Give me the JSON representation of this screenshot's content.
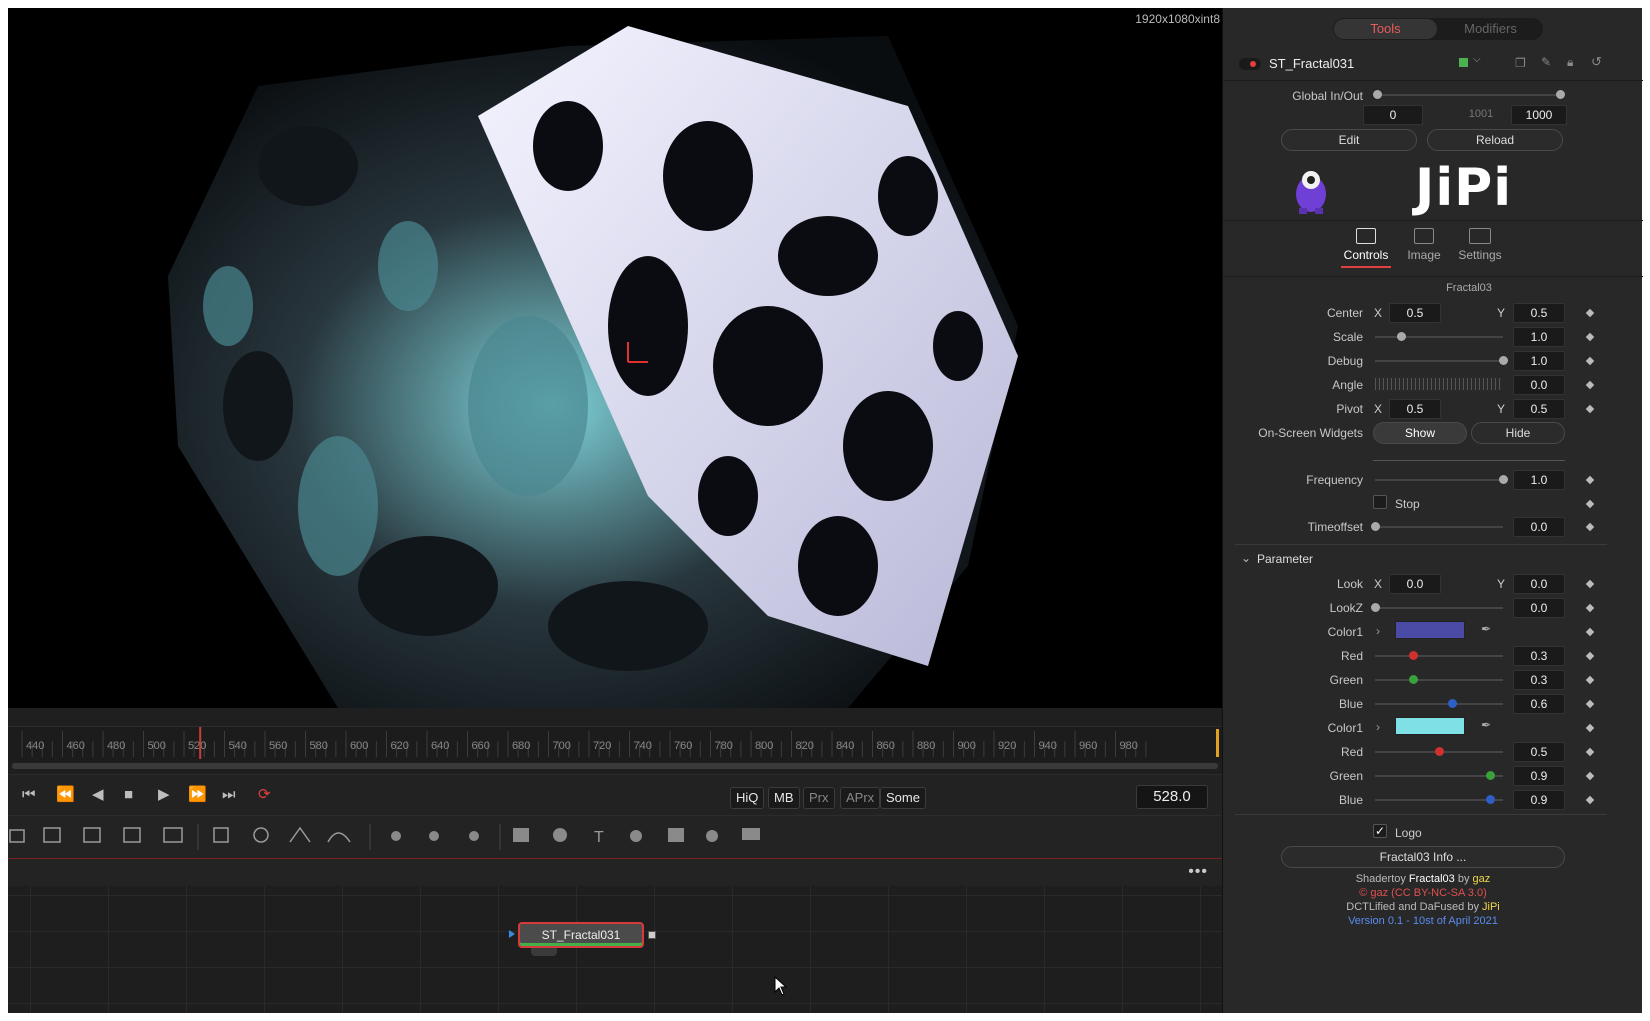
{
  "viewer": {
    "resolution": "1920x1080xint8"
  },
  "timeline": {
    "ticks": [
      "440",
      "460",
      "480",
      "500",
      "520",
      "540",
      "560",
      "580",
      "600",
      "620",
      "640",
      "660",
      "680",
      "700",
      "720",
      "740",
      "760",
      "780",
      "800",
      "820",
      "840",
      "860",
      "880",
      "900",
      "920",
      "940",
      "960",
      "980"
    ],
    "current_frame": "528.0"
  },
  "playback": {
    "hiq": "HiQ",
    "mb": "MB",
    "prx": "Prx",
    "aprx": "APrx",
    "some": "Some"
  },
  "flow": {
    "node_name": "ST_Fractal031"
  },
  "inspector": {
    "tabs": {
      "tools": "Tools",
      "modifiers": "Modifiers"
    },
    "tool_name": "ST_Fractal031",
    "global_label": "Global In/Out",
    "global_in": "0",
    "global_mid": "1001",
    "global_out": "1000",
    "edit": "Edit",
    "reload": "Reload",
    "logo_text": "JiPi",
    "subtabs": {
      "controls": "Controls",
      "image": "Image",
      "settings": "Settings"
    },
    "section_title": "Fractal03",
    "center": {
      "label": "Center",
      "x_label": "X",
      "x": "0.5",
      "y_label": "Y",
      "y": "0.5"
    },
    "scale": {
      "label": "Scale",
      "value": "1.0",
      "level": 0.2
    },
    "debug": {
      "label": "Debug",
      "value": "1.0",
      "level": 1.0
    },
    "angle": {
      "label": "Angle",
      "value": "0.0"
    },
    "pivot": {
      "label": "Pivot",
      "x_label": "X",
      "x": "0.5",
      "y_label": "Y",
      "y": "0.5"
    },
    "widgets": {
      "label": "On-Screen Widgets",
      "show": "Show",
      "hide": "Hide"
    },
    "frequency": {
      "label": "Frequency",
      "value": "1.0",
      "level": 1.0
    },
    "stop": {
      "label": "Stop"
    },
    "timeoffset": {
      "label": "Timeoffset",
      "value": "0.0",
      "level": 0
    },
    "parameter_header": "Parameter",
    "look": {
      "label": "Look",
      "x_label": "X",
      "x": "0.0",
      "y_label": "Y",
      "y": "0.0"
    },
    "lookz": {
      "label": "LookZ",
      "value": "0.0",
      "level": 0
    },
    "color1a": {
      "label": "Color1",
      "swatch": "#4b4ba6",
      "red": {
        "label": "Red",
        "value": "0.3",
        "level": 0.3
      },
      "green": {
        "label": "Green",
        "value": "0.3",
        "level": 0.3
      },
      "blue": {
        "label": "Blue",
        "value": "0.6",
        "level": 0.6
      }
    },
    "color1b": {
      "label": "Color1",
      "swatch": "#7fe0e6",
      "red": {
        "label": "Red",
        "value": "0.5",
        "level": 0.5
      },
      "green": {
        "label": "Green",
        "value": "0.9",
        "level": 0.9
      },
      "blue": {
        "label": "Blue",
        "value": "0.9",
        "level": 0.9
      }
    },
    "logo_check": {
      "label": "Logo"
    },
    "info_button": "Fractal03 Info ...",
    "credits": {
      "l1a": "Shadertoy ",
      "l1b": "Fractal03",
      "l1c": " by ",
      "l1d": "gaz",
      "l2": "© gaz (CC BY-NC-SA 3.0)",
      "l3a": "DCTLified and DaFused by ",
      "l3b": "JiPi",
      "l4": "Version 0.1 - 10st of April 2021"
    }
  }
}
